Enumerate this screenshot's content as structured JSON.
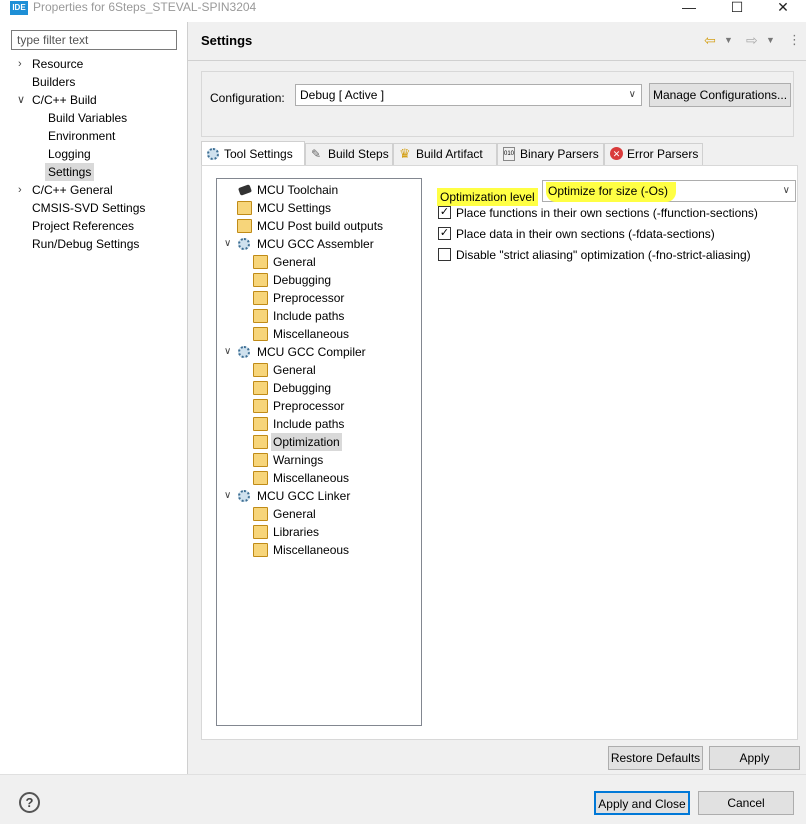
{
  "window": {
    "app_badge": "IDE",
    "title": "Properties for 6Steps_STEVAL-SPIN3204",
    "minimize": "—",
    "maximize": "☐",
    "close": "✕"
  },
  "left": {
    "filter_placeholder": "type filter text",
    "items": [
      {
        "label": "Resource",
        "chevron": "›"
      },
      {
        "label": "Builders"
      },
      {
        "label": "C/C++ Build",
        "chevron": "∨"
      },
      {
        "label": "Build Variables"
      },
      {
        "label": "Environment"
      },
      {
        "label": "Logging"
      },
      {
        "label": "Settings",
        "selected": true
      },
      {
        "label": "C/C++ General",
        "chevron": "›"
      },
      {
        "label": "CMSIS-SVD Settings"
      },
      {
        "label": "Project References"
      },
      {
        "label": "Run/Debug Settings"
      }
    ]
  },
  "right": {
    "title": "Settings",
    "configuration_label": "Configuration:",
    "configuration_value": "Debug  [ Active ]",
    "manage_button": "Manage Configurations...",
    "tabs": [
      {
        "label": "Tool Settings",
        "icon": "tool-settings-icon",
        "active": true
      },
      {
        "label": "Build Steps",
        "icon": "build-steps-icon"
      },
      {
        "label": "Build Artifact",
        "icon": "trophy-icon"
      },
      {
        "label": "Binary Parsers",
        "icon": "binary-icon"
      },
      {
        "label": "Error Parsers",
        "icon": "error-icon"
      }
    ],
    "tree": [
      {
        "label": "MCU Toolchain",
        "icon": "chip-icon"
      },
      {
        "label": "MCU Settings",
        "icon": "folder-icon"
      },
      {
        "label": "MCU Post build outputs",
        "icon": "folder-icon"
      },
      {
        "label": "MCU GCC Assembler",
        "icon": "gear-icon",
        "expanded": true
      },
      {
        "label": "General",
        "icon": "folder-icon"
      },
      {
        "label": "Debugging",
        "icon": "folder-icon"
      },
      {
        "label": "Preprocessor",
        "icon": "folder-icon"
      },
      {
        "label": "Include paths",
        "icon": "folder-icon"
      },
      {
        "label": "Miscellaneous",
        "icon": "folder-icon"
      },
      {
        "label": "MCU GCC Compiler",
        "icon": "gear-icon",
        "expanded": true
      },
      {
        "label": "General",
        "icon": "folder-icon"
      },
      {
        "label": "Debugging",
        "icon": "folder-icon"
      },
      {
        "label": "Preprocessor",
        "icon": "folder-icon"
      },
      {
        "label": "Include paths",
        "icon": "folder-icon"
      },
      {
        "label": "Optimization",
        "icon": "folder-icon",
        "selected": true
      },
      {
        "label": "Warnings",
        "icon": "folder-icon"
      },
      {
        "label": "Miscellaneous",
        "icon": "folder-icon"
      },
      {
        "label": "MCU GCC Linker",
        "icon": "gear-icon",
        "expanded": true
      },
      {
        "label": "General",
        "icon": "folder-icon"
      },
      {
        "label": "Libraries",
        "icon": "folder-icon"
      },
      {
        "label": "Miscellaneous",
        "icon": "folder-icon"
      }
    ],
    "optimization_label": "Optimization level",
    "optimization_value": "Optimize for size (-Os)",
    "checkboxes": [
      {
        "label": "Place functions in their own sections (-ffunction-sections)",
        "checked": true
      },
      {
        "label": "Place data in their own sections (-fdata-sections)",
        "checked": true
      },
      {
        "label": "Disable \"strict aliasing\" optimization (-fno-strict-aliasing)",
        "checked": false
      }
    ],
    "restore_defaults": "Restore Defaults",
    "apply": "Apply"
  },
  "bottom": {
    "help": "?",
    "apply_close": "Apply and Close",
    "cancel": "Cancel"
  },
  "colors": {
    "highlight": "#ffff44",
    "selection": "#d9d9d9",
    "accent": "#0078d7"
  }
}
